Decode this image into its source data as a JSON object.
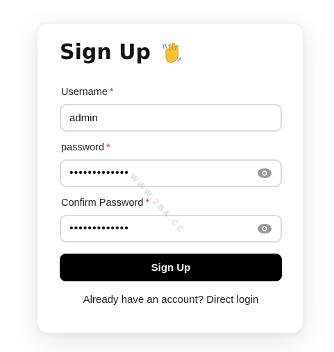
{
  "form": {
    "title": "Sign Up",
    "title_emoji": "waving-hand-icon",
    "required_mark": "*",
    "fields": {
      "username": {
        "label": "Username",
        "value": "admin"
      },
      "password": {
        "label": "password",
        "value": "passwordvalue"
      },
      "confirm_password": {
        "label": "Confirm Password",
        "value": "passwordvalue"
      }
    },
    "submit_label": "Sign Up",
    "login_link": "Already have an account? Direct login"
  },
  "watermark": "WWW.2BA.CC",
  "colors": {
    "button_bg": "#000000",
    "button_text": "#ffffff",
    "required": "#e0245e",
    "input_border": "#dcdcdc",
    "eye_icon": "#9a9a9a"
  }
}
